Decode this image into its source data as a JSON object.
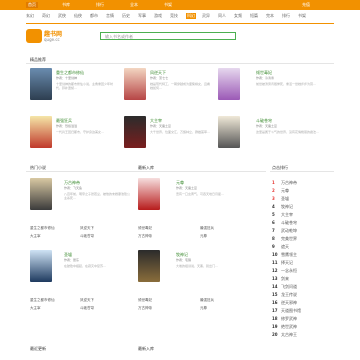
{
  "topnav": {
    "items": [
      "首页",
      "书库",
      "排行",
      "全本",
      "书架",
      "充值"
    ],
    "selected": 0
  },
  "categories": [
    "玄幻",
    "奇幻",
    "武侠",
    "仙侠",
    "都市",
    "言情",
    "历史",
    "军事",
    "游戏",
    "竞技",
    "科幻",
    "灵异",
    "同人",
    "女频",
    "短篇",
    "完本",
    "排行",
    "书架"
  ],
  "active_category": 10,
  "logo": {
    "name": "趣书网",
    "domain": "quge.cc"
  },
  "search": {
    "placeholder": "输入书名或作者"
  },
  "sections": {
    "featured": "精品推荐",
    "hot": "热门小说",
    "rank": "点击排行",
    "new": "最新入库",
    "update": "最近更新"
  },
  "featured_books": [
    {
      "title": "重生之都市修仙",
      "meta": "作者：十里剑神",
      "desc": "十里剑神的都市修仙小说，主角重回少年时代，弥补遗憾..."
    },
    {
      "title": "凤逆天下",
      "meta": "作者：萧七七",
      "desc": "她是现代特工，一朝穿越成为废柴嫡女，且看她如何..."
    },
    {
      "title": "倾世毒妃",
      "meta": "作者：冷清寒",
      "desc": "前世被渣男背叛惨死，重活一世她步步为营..."
    },
    {
      "title": "最强狂兵",
      "meta": "作者：烈焰滔滔",
      "desc": "一代兵王回归都市，守护身边美女..."
    },
    {
      "title": "大主宰",
      "meta": "作者：天蚕土豆",
      "desc": "大千世界，位面交汇，万族林立，群雄荟萃..."
    },
    {
      "title": "斗破苍穹",
      "meta": "作者：天蚕土豆",
      "desc": "这里是属于斗气的世界，没有花俏艳丽的魔法..."
    }
  ],
  "hot_books": [
    {
      "title": "万古神帝",
      "meta": "作者：飞天鱼",
      "desc": "八百年前，明帝之子张若尘，被他的未婚妻池瑶公主杀死..."
    },
    {
      "title": "元尊",
      "meta": "作者：天蚕土豆",
      "desc": "吾有一口玄黄气，可吞天地日月星..."
    },
    {
      "title": "圣墟",
      "meta": "作者：辰东",
      "desc": "在破败中崛起，在寂灭中复苏..."
    },
    {
      "title": "牧神记",
      "meta": "作者：宅猪",
      "desc": "大墟的祖训说，天黑，别出门..."
    }
  ],
  "rank": [
    {
      "num": "1",
      "title": "万古神帝"
    },
    {
      "num": "2",
      "title": "元尊"
    },
    {
      "num": "3",
      "title": "圣墟"
    },
    {
      "num": "4",
      "title": "牧神记"
    },
    {
      "num": "5",
      "title": "大主宰"
    },
    {
      "num": "6",
      "title": "斗破苍穹"
    },
    {
      "num": "7",
      "title": "武动乾坤"
    },
    {
      "num": "8",
      "title": "完美世界"
    },
    {
      "num": "9",
      "title": "遮天"
    },
    {
      "num": "10",
      "title": "雪鹰领主"
    },
    {
      "num": "11",
      "title": "择天记"
    },
    {
      "num": "12",
      "title": "一念永恒"
    },
    {
      "num": "13",
      "title": "剑来"
    },
    {
      "num": "14",
      "title": "飞剑问道"
    },
    {
      "num": "15",
      "title": "龙王传说"
    },
    {
      "num": "16",
      "title": "逆天邪神"
    },
    {
      "num": "17",
      "title": "天道图书馆"
    },
    {
      "num": "18",
      "title": "修罗武神"
    },
    {
      "num": "19",
      "title": "绝世武神"
    },
    {
      "num": "20",
      "title": "太古神王"
    }
  ],
  "list_links": [
    "重生之都市修仙",
    "凤逆天下",
    "倾世毒妃",
    "最强狂兵",
    "大主宰",
    "斗破苍穹",
    "万古神帝",
    "元尊"
  ],
  "colors": {
    "brand": "#f29100",
    "title_green": "#3a8a2e",
    "rank_red": "#e53935"
  }
}
